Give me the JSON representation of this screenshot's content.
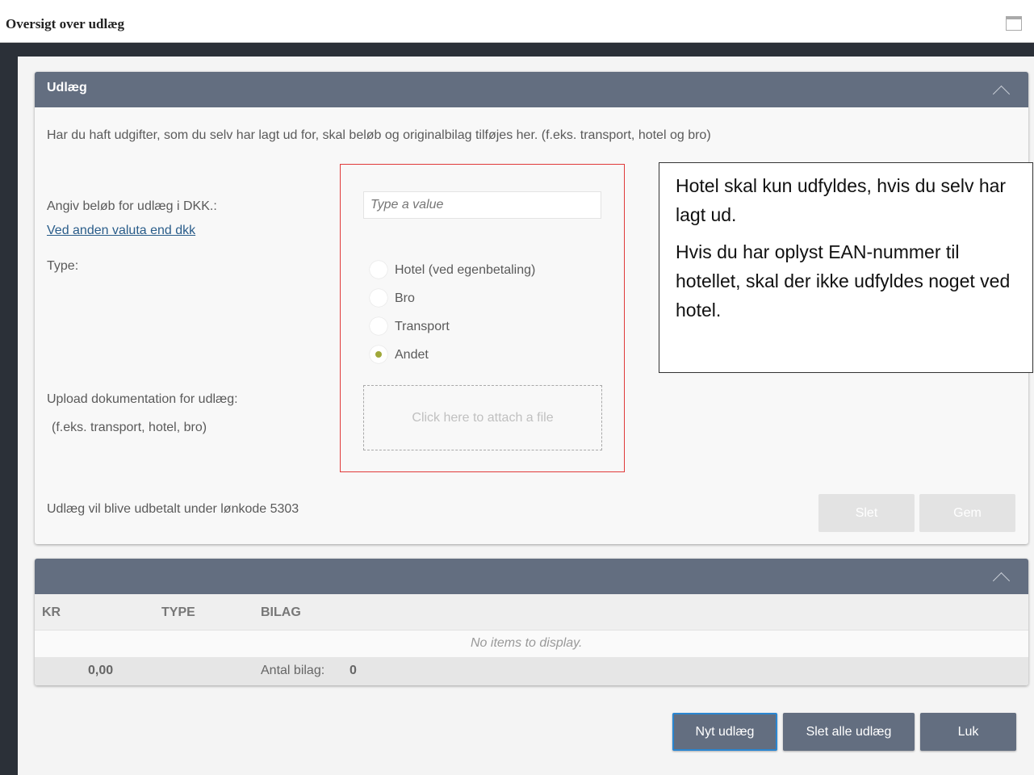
{
  "window": {
    "title": "Oversigt over udlæg",
    "maximize_icon": "maximize-icon"
  },
  "udlaeg_panel": {
    "header": "Udlæg",
    "collapse_icon": "chevron-up-icon",
    "intro": "Har du haft udgifter, som du selv har lagt ud for, skal beløb og originalbilag tilføjes her.  (f.eks. transport, hotel og bro)",
    "amount_label": "Angiv beløb for udlæg i DKK.:",
    "currency_link": "Ved anden valuta end dkk",
    "amount_placeholder": "Type a value",
    "type_label": "Type:",
    "type_options": [
      {
        "label": "Hotel (ved egenbetaling)",
        "selected": false
      },
      {
        "label": "Bro",
        "selected": false
      },
      {
        "label": "Transport",
        "selected": false
      },
      {
        "label": "Andet",
        "selected": true
      }
    ],
    "upload_label": "Upload dokumentation for udlæg:",
    "upload_hint": "(f.eks. transport, hotel, bro)",
    "upload_area": "Click here to attach a file",
    "footer_note": "Udlæg vil blive udbetalt under lønkode 5303",
    "delete_label": "Slet",
    "save_label": "Gem"
  },
  "annotation": {
    "line1": "Hotel skal kun udfyldes, hvis du selv har lagt ud.",
    "line2": "Hvis du har oplyst EAN-nummer til hotellet, skal der ikke udfyldes noget ved hotel."
  },
  "table_panel": {
    "collapse_icon": "chevron-up-icon",
    "columns": [
      "KR",
      "TYPE",
      "BILAG"
    ],
    "empty_text": "No items to display.",
    "total_amount": "0,00",
    "count_label": "Antal bilag:",
    "count_value": "0"
  },
  "actions": {
    "new_label": "Nyt udlæg",
    "delete_all_label": "Slet alle udlæg",
    "close_label": "Luk"
  },
  "colors": {
    "header": "#636e80",
    "selected_radio": "#a0a83a",
    "highlight": "#e03a3a"
  }
}
